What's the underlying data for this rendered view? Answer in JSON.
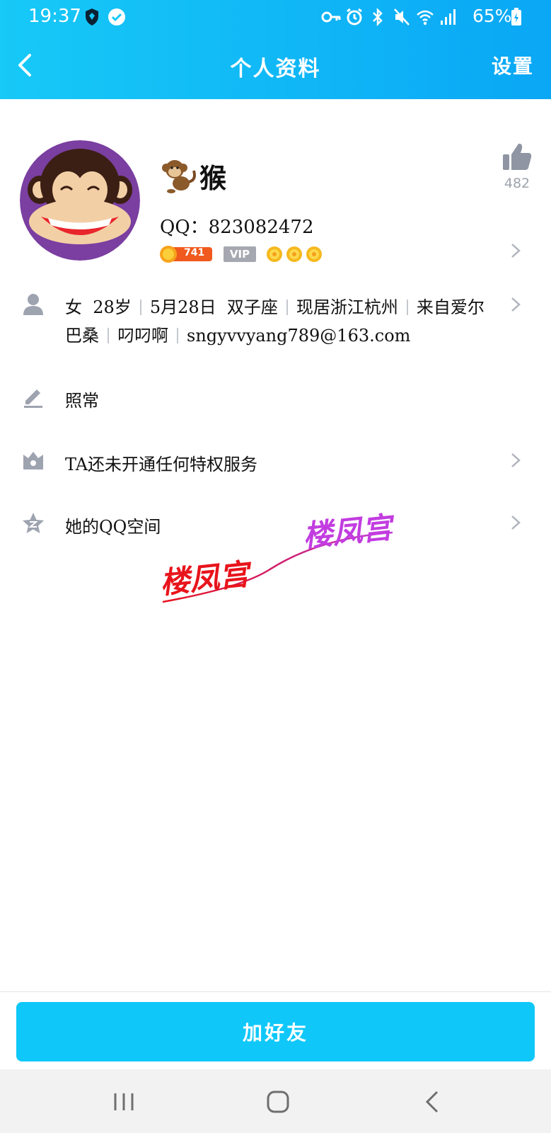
{
  "status_bar": {
    "time": "19:37",
    "battery": "65%",
    "icons": [
      "shield-icon",
      "check-circle-icon",
      "key-icon",
      "alarm-icon",
      "bluetooth-icon",
      "mute-icon",
      "wifi-icon",
      "signal-icon",
      "battery-icon"
    ]
  },
  "header": {
    "title": "个人资料",
    "settings_label": "设置",
    "background": "#0fb6f6"
  },
  "profile": {
    "nickname": "猴",
    "qq_label": "QQ：823082472",
    "level": "741",
    "vip_label": "VIP",
    "like_count": "482"
  },
  "info": {
    "gender": "女",
    "age": "28岁",
    "birthday": "5月28日",
    "zodiac": "双子座",
    "location": "现居浙江杭州",
    "hometown_part1": "来自爱尔",
    "hometown_part2": "巴桑",
    "company": "叼叼啊",
    "email": "sngyvvyang789@163.com"
  },
  "signature": "照常",
  "privilege": "TA还未开通任何特权服务",
  "qzone": "她的QQ空间",
  "watermark": {
    "text1": "楼凤宫",
    "text2": "楼凤宫",
    "color1": "#e8141c",
    "color2": "#c23de0"
  },
  "actions": {
    "add_friend": "加好友",
    "accent": "#0fc8f9"
  }
}
